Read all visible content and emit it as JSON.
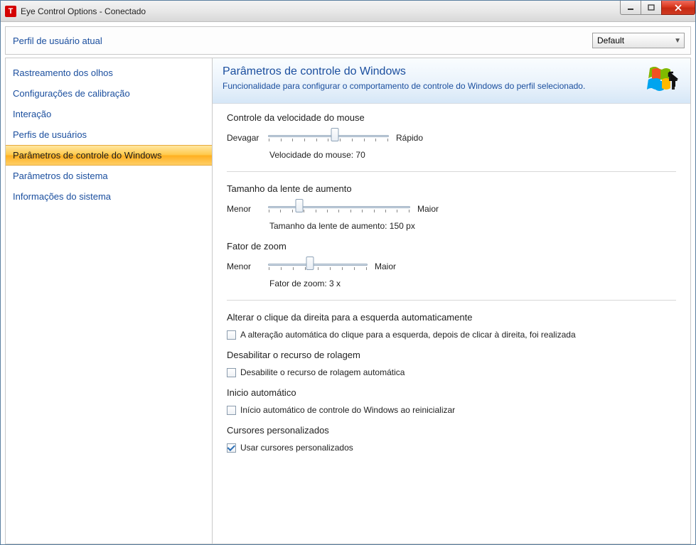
{
  "window": {
    "title": "Eye Control Options - Conectado"
  },
  "profile": {
    "label": "Perfil de usuário atual",
    "selected": "Default"
  },
  "sidebar": {
    "items": [
      {
        "label": "Rastreamento dos olhos"
      },
      {
        "label": "Configurações de calibração"
      },
      {
        "label": "Interação"
      },
      {
        "label": "Perfis de usuários"
      },
      {
        "label": "Parâmetros de controle do Windows"
      },
      {
        "label": "Parâmetros do sistema"
      },
      {
        "label": "Informações do sistema"
      }
    ],
    "selected_index": 4
  },
  "main": {
    "title": "Parâmetros de controle do Windows",
    "subtitle": "Funcionalidade para configurar o comportamento de controle do Windows do perfil selecionado.",
    "mouse_speed": {
      "title": "Controle da velocidade do mouse",
      "min_label": "Devagar",
      "max_label": "Rápido",
      "value_label": "Velocidade do mouse: 70",
      "percent": 55
    },
    "lens_size": {
      "title": "Tamanho da lente de aumento",
      "min_label": "Menor",
      "max_label": "Maior",
      "value_label": "Tamanho da lente de aumento: 150 px",
      "percent": 22
    },
    "zoom": {
      "title": "Fator de zoom",
      "min_label": "Menor",
      "max_label": "Maior",
      "value_label": "Fator de zoom: 3 x",
      "percent": 42
    },
    "auto_click": {
      "title": "Alterar o clique da direita para a esquerda automaticamente",
      "checkbox_label": "A alteração automática do clique para a esquerda, depois de clicar à direita, foi realizada",
      "checked": false
    },
    "disable_scroll": {
      "title": "Desabilitar o recurso de rolagem",
      "checkbox_label": "Desabilite o recurso de rolagem automática",
      "checked": false
    },
    "autostart": {
      "title": "Inicio automático",
      "checkbox_label": "Início automático de controle do Windows ao reinicializar",
      "checked": false
    },
    "custom_cursors": {
      "title": "Cursores personalizados",
      "checkbox_label": "Usar cursores personalizados",
      "checked": true
    }
  }
}
